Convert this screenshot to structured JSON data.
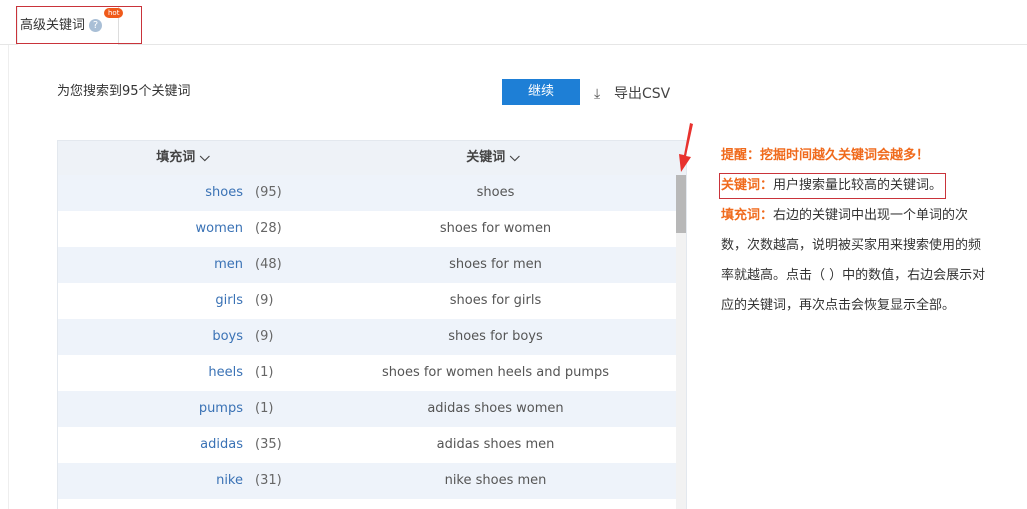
{
  "tab": {
    "label": "高级关键词",
    "badge": "hot",
    "help": "?"
  },
  "found_text": "为您搜索到95个关键词",
  "continue_label": "继续",
  "export_label": "导出CSV",
  "table": {
    "headers": [
      "填充词 ⌵",
      "关键词 ⌵"
    ],
    "rows": [
      {
        "fill": "shoes",
        "count": "(95)",
        "keyword": "shoes"
      },
      {
        "fill": "women",
        "count": "(28)",
        "keyword": "shoes for women"
      },
      {
        "fill": "men",
        "count": "(48)",
        "keyword": "shoes for men"
      },
      {
        "fill": "girls",
        "count": "(9)",
        "keyword": "shoes for girls"
      },
      {
        "fill": "boys",
        "count": "(9)",
        "keyword": "shoes for boys"
      },
      {
        "fill": "heels",
        "count": "(1)",
        "keyword": "shoes for women heels and pumps"
      },
      {
        "fill": "pumps",
        "count": "(1)",
        "keyword": "adidas shoes women"
      },
      {
        "fill": "adidas",
        "count": "(35)",
        "keyword": "adidas shoes men"
      },
      {
        "fill": "nike",
        "count": "(31)",
        "keyword": "nike shoes men"
      },
      {
        "fill": "",
        "count": "",
        "keyword": ""
      }
    ]
  },
  "notes": {
    "tip": "提醒：挖掘时间越久关键词会越多！",
    "kw_label": "关键词：",
    "kw_text": "用户搜索量比较高的关键词。",
    "fill_label": "填充词：",
    "fill_text": "右边的关键词中出现一个单词的次数，次数越高，说明被买家用来搜索使用的频率就越高。点击（ ）中的数值，右边会展示对应的关键词，再次点击会恢复显示全部。"
  }
}
